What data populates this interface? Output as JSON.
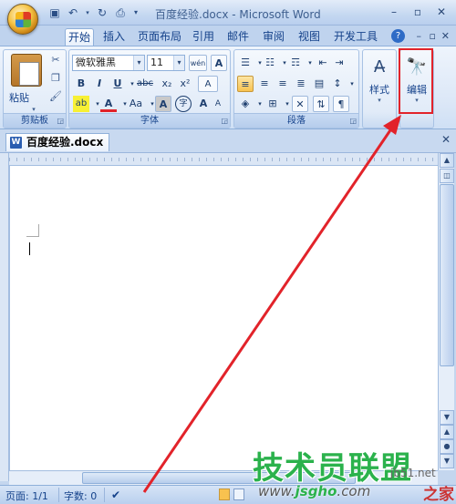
{
  "window": {
    "title": "百度经验.docx - Microsoft Word"
  },
  "qat": {
    "save_icon": "save-icon",
    "undo_icon": "undo-icon",
    "redo_icon": "redo-icon",
    "preview_icon": "print-preview-icon"
  },
  "tabs": [
    {
      "label": "开始",
      "active": true
    },
    {
      "label": "插入"
    },
    {
      "label": "页面布局"
    },
    {
      "label": "引用"
    },
    {
      "label": "邮件"
    },
    {
      "label": "审阅"
    },
    {
      "label": "视图"
    },
    {
      "label": "开发工具"
    }
  ],
  "ribbon": {
    "clipboard": {
      "label": "剪贴板",
      "paste_label": "粘贴"
    },
    "font": {
      "label": "字体",
      "font_name": "微软雅黑",
      "font_size": "11",
      "bold": "B",
      "italic": "I",
      "underline": "U",
      "strike": "abc",
      "subscript": "x₂",
      "superscript": "x²",
      "clear_format": "A",
      "text_effects": "A",
      "font_color": "A",
      "font_size_case": "Aa",
      "char_shading": "A",
      "char_border": "字",
      "grow": "A",
      "shrink": "A",
      "phonetic": "wén",
      "highlight": "ab"
    },
    "paragraph": {
      "label": "段落"
    },
    "styles": {
      "label": "样式"
    },
    "editing": {
      "label": "编辑"
    }
  },
  "document": {
    "tab_label": "百度经验.docx"
  },
  "status": {
    "page": "页面: 1/1",
    "words": "字数: 0"
  },
  "annotation": {
    "color": "#e2232a"
  },
  "watermark": {
    "main": "技术员联盟",
    "url_prefix": "www.",
    "url_domain": "jsgho",
    "url_suffix": ".com",
    "site": "jb51.net",
    "jia": "之家"
  }
}
